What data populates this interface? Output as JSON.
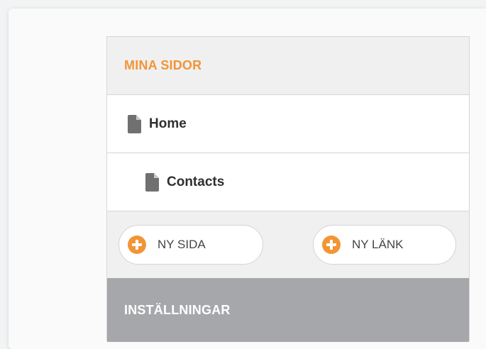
{
  "panel": {
    "header": "MINA SIDOR",
    "pages": [
      {
        "label": "Home",
        "icon": "document-icon"
      },
      {
        "label": "Contacts",
        "icon": "document-icon"
      }
    ],
    "actions": {
      "new_page_label": "NY SIDA",
      "new_link_label": "NY LÄNK",
      "add_icon": "plus-circle-icon"
    },
    "settings_header": "INSTÄLLNINGAR"
  },
  "colors": {
    "accent": "#f29536",
    "settings_bg": "#a6a7aa",
    "icon_gray": "#707070"
  }
}
